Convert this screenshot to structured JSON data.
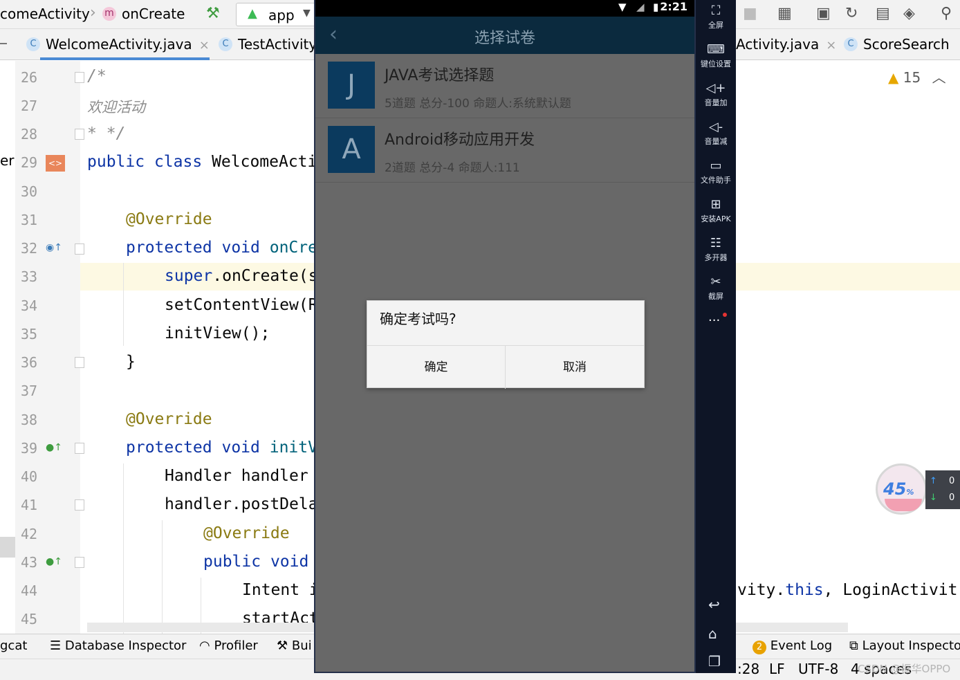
{
  "ide": {
    "breadcrumb": {
      "class_name": "comeActivity",
      "method_badge": "m",
      "method_name": "onCreate"
    },
    "run_config": "app",
    "tabs": [
      {
        "badge": "C",
        "label": "WelcomeActivity.java",
        "close": "×"
      },
      {
        "badge": "C",
        "label": "TestActivity"
      },
      {
        "label": "Activity.java",
        "close": "×"
      },
      {
        "badge": "C",
        "label": "ScoreSearch"
      }
    ],
    "warnings_count": "15",
    "line_numbers": [
      "26",
      "27",
      "28",
      "29",
      "30",
      "31",
      "32",
      "33",
      "34",
      "35",
      "36",
      "37",
      "38",
      "39",
      "40",
      "41",
      "42",
      "43",
      "44",
      "45"
    ],
    "code": {
      "l26": "/*",
      "l27": "欢迎活动",
      "l28": "* */",
      "l29_kw1": "public",
      "l29_kw2": "class",
      "l29_rest": "WelcomeActi",
      "l31": "@Override",
      "l32_kw1": "protected",
      "l32_kw2": "void",
      "l32_name": "onCre",
      "l33_kw": "super",
      "l33_rest": ".onCreate(s",
      "l34": "setContentView(R",
      "l35": "initView();",
      "l36": "}",
      "l38": "@Override",
      "l39_kw1": "protected",
      "l39_kw2": "void",
      "l39_name": "initV",
      "l40": "Handler handler",
      "l41": "handler.postDela",
      "l42": "@Override",
      "l43_kw1": "public",
      "l43_kw2": "void",
      "l44": "Intent i",
      "l44_right_a": "vity.",
      "l44_right_kw": "this",
      "l44_right_b": ", LoginActivit",
      "l45": "startAct"
    },
    "tool_windows": {
      "logcat": "gcat",
      "database_inspector": "Database Inspector",
      "profiler": "Profiler",
      "build": "Bui",
      "event_log_count": "2",
      "event_log": "Event Log",
      "layout_inspector": "Layout Inspector"
    },
    "status": {
      "position": ":28",
      "line_sep": "LF",
      "encoding": "UTF-8",
      "indent": "4 spaces"
    },
    "watermark": "CSDN @振华OPPO"
  },
  "emulator": {
    "status_time": "2:21",
    "appbar_title": "选择试卷",
    "quizzes": [
      {
        "letter": "J",
        "title": "JAVA考试选择题",
        "meta": "5道题 总分-100 命题人:系统默认题"
      },
      {
        "letter": "A",
        "title": "Android移动应用开发",
        "meta": "2道题 总分-4 命题人:111"
      }
    ],
    "dialog": {
      "message": "确定考试吗?",
      "confirm": "确定",
      "cancel": "取消"
    }
  },
  "side_panel": {
    "buttons": [
      {
        "icon": "fullscreen-icon",
        "label": "全屏"
      },
      {
        "icon": "keyboard-icon",
        "label": "键位设置"
      },
      {
        "icon": "volume-up-icon",
        "label": "音量加"
      },
      {
        "icon": "volume-down-icon",
        "label": "音量减"
      },
      {
        "icon": "file-helper-icon",
        "label": "文件助手"
      },
      {
        "icon": "install-apk-icon",
        "label": "安装APK"
      },
      {
        "icon": "multi-instance-icon",
        "label": "多开器"
      },
      {
        "icon": "screenshot-icon",
        "label": "截屏"
      }
    ],
    "more": "..."
  },
  "float_widget": {
    "percent": "45",
    "percent_sign": "%",
    "up": "0",
    "down": "0"
  },
  "colors": {
    "keyword": "#0d34a5",
    "annotation": "#8a7a12",
    "appbar": "#0b2a3e",
    "quiz_badge": "#0b3a5e",
    "side_panel": "#0e1526"
  }
}
